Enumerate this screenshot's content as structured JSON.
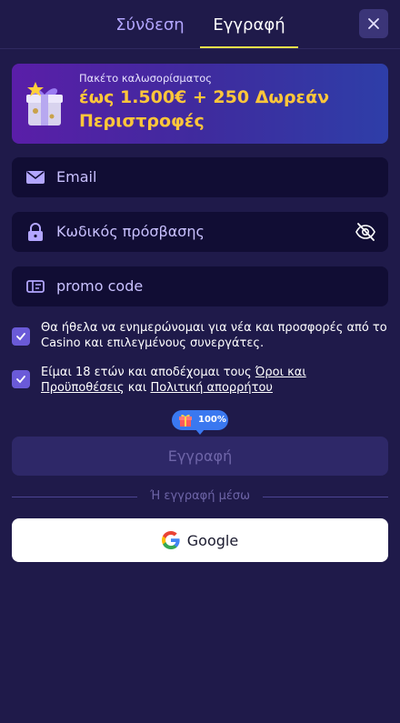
{
  "tabs": {
    "login_label": "Σύνδεση",
    "register_label": "Εγγραφή",
    "active": "register"
  },
  "banner": {
    "subtitle": "Πακέτο καλωσορίσματος",
    "line1_prefix": "έως ",
    "line1_highlight": "1.500€ + 250",
    "line1_suffix": " Δωρεάν",
    "line2": "Περιστροφές",
    "icon": "gift-box-icon"
  },
  "form": {
    "email_placeholder": "Email",
    "password_placeholder": "Κωδικός πρόσβασης",
    "promo_placeholder": "promo code"
  },
  "consents": {
    "newsletter_text": "Θα ήθελα να ενημερώνομαι για νέα και προσφορές από το Casino και επιλεγμένους συνεργάτες.",
    "terms_prefix": "Είμαι 18 ετών και αποδέχομαι τους ",
    "terms_link": "Όροι και Προϋποθέσεις",
    "terms_middle": " και ",
    "privacy_link": "Πολιτική απορρήτου"
  },
  "progress": {
    "percent_label": "100%",
    "value": 1.0
  },
  "submit_label": "Εγγραφή",
  "divider_text": "Ή εγγραφή μέσω",
  "google_label": "Google",
  "colors": {
    "background": "#1f1a4a",
    "accent_underline": "#f2e24a",
    "banner_text": "#ffc63a",
    "checkbox": "#6a5ad8",
    "badge": "#3a78f0"
  }
}
